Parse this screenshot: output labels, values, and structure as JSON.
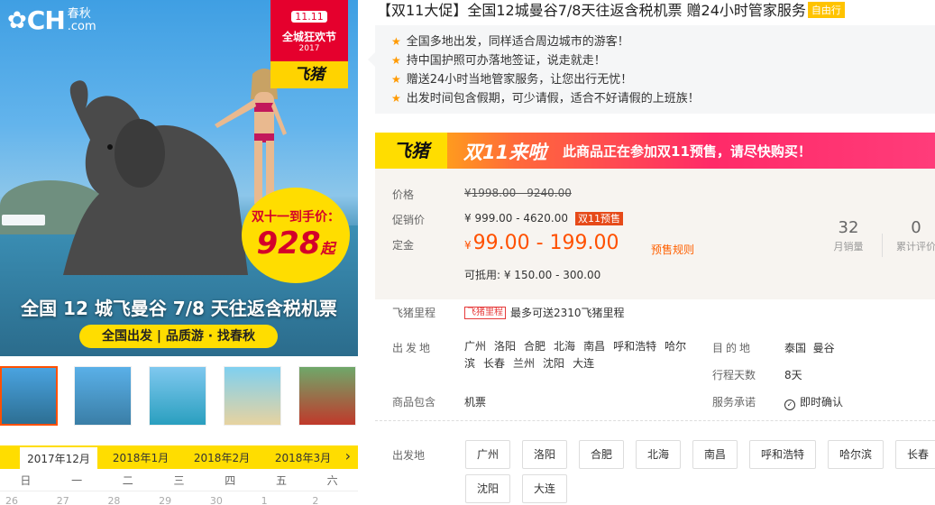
{
  "hero": {
    "logo_mark": "✿",
    "logo_ch": "CH",
    "logo_cn": "春秋",
    "logo_dot": ".com",
    "badge_date": "11.11",
    "badge_name": "全城狂欢节",
    "badge_year": "2017",
    "badge_brand": "飞猪",
    "price_label": "双十一到手价：",
    "price_value": "928",
    "price_suffix": "起",
    "title": "全国 12 城飞曼谷 7/8 天往返含税机票",
    "pill": "全国出发 | 品质游 · 找春秋"
  },
  "calendar": {
    "months": [
      "2017年12月",
      "2018年1月",
      "2018年2月",
      "2018年3月"
    ],
    "next_icon": "chevron-right-icon",
    "weekdays": [
      "日",
      "一",
      "二",
      "三",
      "四",
      "五",
      "六"
    ],
    "days": [
      "26",
      "27",
      "28",
      "29",
      "30",
      "1",
      "2"
    ]
  },
  "product": {
    "title": "【双11大促】全国12城曼谷7/8天往返含税机票 赠24小时管家服务",
    "tag": "自由行",
    "features": [
      "全国多地出发，同样适合周边城市的游客！",
      "持中国护照可办落地签证，说走就走！",
      "赠送24小时当地管家服务，让您出行无忧！",
      "出发时间包含假期，可少请假，适合不好请假的上班族！"
    ]
  },
  "promo": {
    "brand": "飞猪",
    "double11": "双11来啦",
    "message": "此商品正在参加双11预售，请尽快购买！"
  },
  "pricing": {
    "price_label": "价格",
    "price_value": "¥1998.00 - 9240.00",
    "promo_label": "促销价",
    "promo_value": "¥ 999.00 - 4620.00",
    "promo_tag": "双11预售",
    "deposit_label": "定金",
    "deposit_currency": "¥",
    "deposit_value": "99.00 - 199.00",
    "presale_rule": "预售规则",
    "offset_value": "可抵用: ¥ 150.00 - 300.00",
    "monthly_sales": "32",
    "monthly_sales_label": "月销量",
    "total_reviews": "0",
    "total_reviews_label": "累计评价"
  },
  "miles": {
    "label": "飞猪里程",
    "tag": "飞猪里程",
    "text": "最多可送2310飞猪里程"
  },
  "info": {
    "departure_label": "出发地",
    "departure_cities": [
      "广州",
      "洛阳",
      "合肥",
      "北海",
      "南昌",
      "呼和浩特",
      "哈尔滨",
      "长春",
      "兰州",
      "沈阳",
      "大连"
    ],
    "destination_label": "目的地",
    "destination_value": "泰国  曼谷",
    "days_label": "行程天数",
    "days_value": "8天",
    "includes_label": "商品包含",
    "includes_value": "机票",
    "service_label": "服务承诺",
    "service_value": "即时确认"
  },
  "selector": {
    "label": "出发地",
    "options": [
      "广州",
      "洛阳",
      "合肥",
      "北海",
      "南昌",
      "呼和浩特",
      "哈尔滨",
      "长春",
      "沈阳",
      "大连"
    ]
  }
}
